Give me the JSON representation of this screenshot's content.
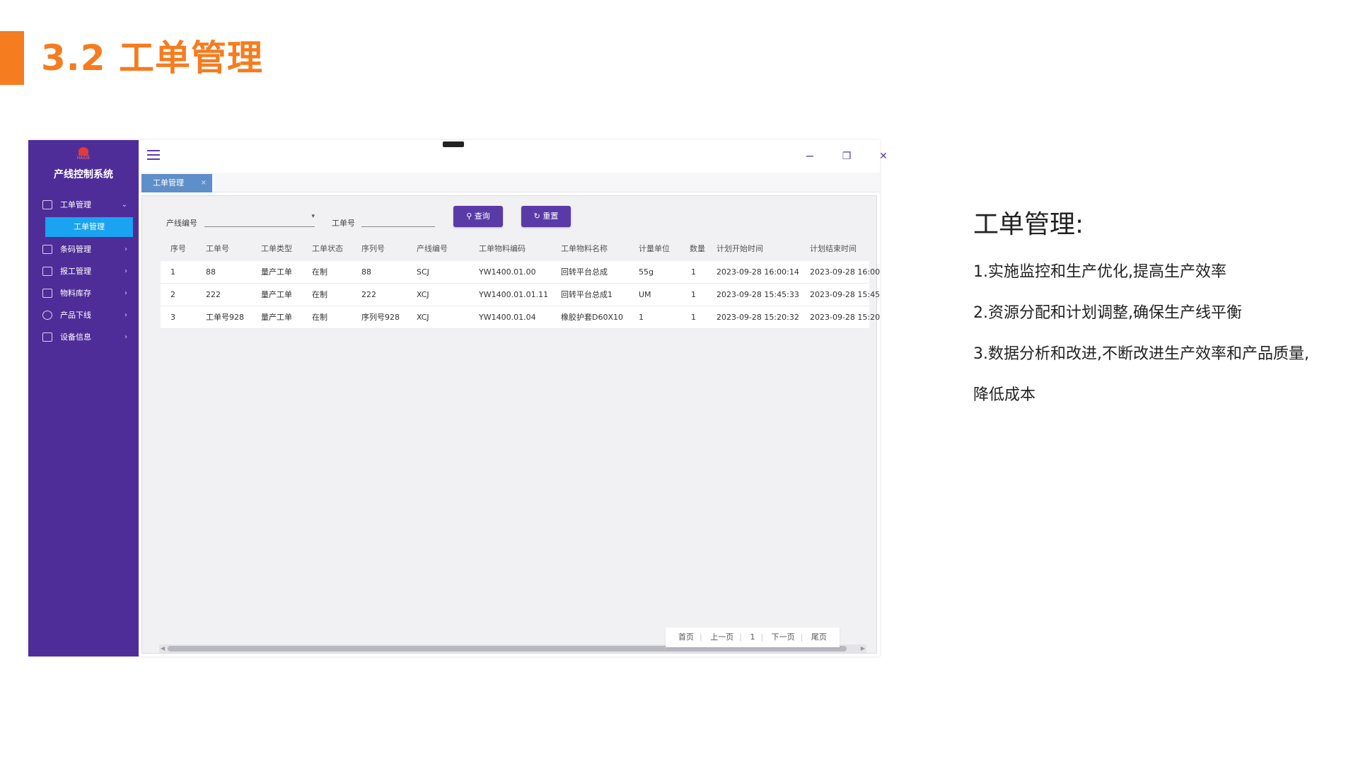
{
  "slide": {
    "title": "3.2 工单管理"
  },
  "app": {
    "system_title": "产线控制系统",
    "logo_text": "HAIDE",
    "menu": [
      {
        "label": "工单管理",
        "icon": "cart-icon",
        "expanded": true
      },
      {
        "label": "条码管理",
        "icon": "printer-icon"
      },
      {
        "label": "报工管理",
        "icon": "report-icon"
      },
      {
        "label": "物料库存",
        "icon": "inventory-icon"
      },
      {
        "label": "产品下线",
        "icon": "offline-icon"
      },
      {
        "label": "设备信息",
        "icon": "device-icon"
      }
    ],
    "submenu_active": "工单管理",
    "window": {
      "minimize": "−",
      "restore": "❐",
      "close": "✕"
    },
    "tab": {
      "label": "工单管理",
      "close": "×"
    },
    "filters": {
      "line_label": "产线编号",
      "line_value": "",
      "order_label": "工单号",
      "order_value": ""
    },
    "buttons": {
      "query": "查询",
      "reset": "重置",
      "query_icon": "search-icon",
      "reset_icon": "refresh-icon"
    },
    "table": {
      "headers": [
        "序号",
        "工单号",
        "工单类型",
        "工单状态",
        "序列号",
        "产线编号",
        "工单物料编码",
        "工单物料名称",
        "计量单位",
        "数量",
        "计划开始时间",
        "计划结束时间"
      ],
      "rows": [
        [
          "1",
          "88",
          "量产工单",
          "在制",
          "88",
          "SCJ",
          "YW1400.01.00",
          "回转平台总成",
          "55g",
          "1",
          "2023-09-28 16:00:14",
          "2023-09-28 16:00"
        ],
        [
          "2",
          "222",
          "量产工单",
          "在制",
          "222",
          "XCJ",
          "YW1400.01.01.11",
          "回转平台总成1",
          "UM",
          "1",
          "2023-09-28 15:45:33",
          "2023-09-28 15:45"
        ],
        [
          "3",
          "工单号928",
          "量产工单",
          "在制",
          "序列号928",
          "XCJ",
          "YW1400.01.04",
          "橡胶护套D60X10",
          "1",
          "1",
          "2023-09-28 15:20:32",
          "2023-09-28 15:20"
        ]
      ]
    },
    "pager": {
      "first": "首页",
      "prev": "上一页",
      "page": "1",
      "next": "下一页",
      "last": "尾页"
    }
  },
  "description": {
    "heading": "工单管理:",
    "lines": [
      "1.实施监控和生产优化,提高生产效率",
      "2.资源分配和计划调整,确保生产线平衡",
      "3.数据分析和改进,不断改进生产效率和产品质量,",
      "降低成本"
    ]
  },
  "colors": {
    "accent": "#f57c1f",
    "sidebar": "#4f2d98",
    "button": "#5a3aa6",
    "active_menu": "#1aa3f0"
  }
}
